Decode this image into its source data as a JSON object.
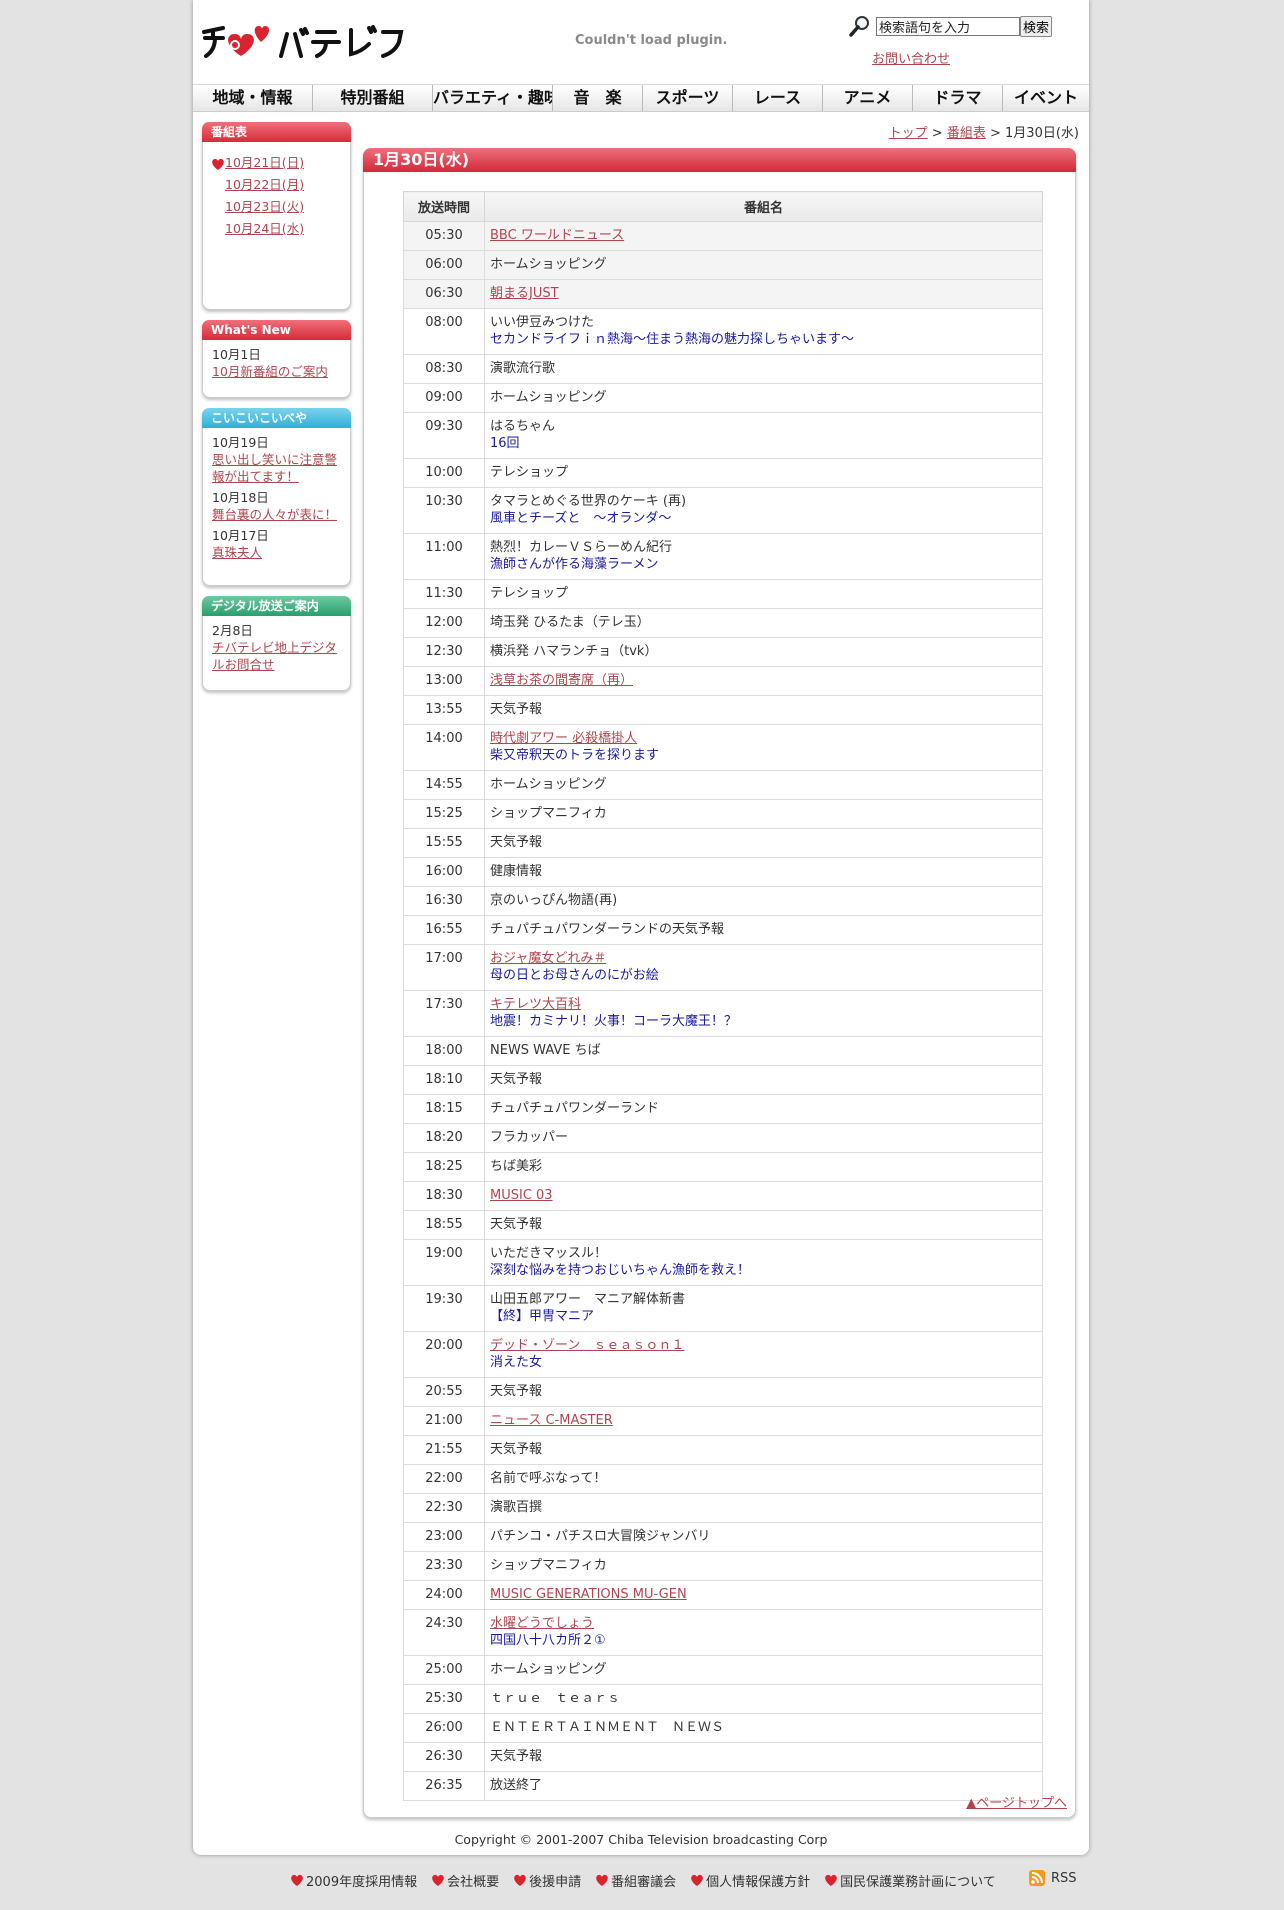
{
  "header": {
    "logo_text": "チバテレビ",
    "plugin_message": "Couldn't load plugin.",
    "search": {
      "value": "検索語句を入力",
      "button": "検索"
    },
    "contact": "お問い合わせ"
  },
  "nav": [
    {
      "label": "地域・情報",
      "width": 120
    },
    {
      "label": "特別番組",
      "width": 120
    },
    {
      "label": "バラエティ・趣味",
      "width": 120
    },
    {
      "label": "音　楽",
      "width": 90
    },
    {
      "label": "スポーツ",
      "width": 90
    },
    {
      "label": "レース",
      "width": 90
    },
    {
      "label": "アニメ",
      "width": 90
    },
    {
      "label": "ドラマ",
      "width": 90
    },
    {
      "label": "イベント",
      "width": 86
    }
  ],
  "sidebar": {
    "schedule": {
      "title": "番組表",
      "days": [
        "10月21日(日)",
        "10月22日(月)",
        "10月23日(火)",
        "10月24日(水)"
      ]
    },
    "whats_new": {
      "title": "What's New",
      "items": [
        {
          "date": "10月1日",
          "text": "10月新番組のご案内"
        }
      ]
    },
    "koikoi": {
      "title": "こいこいこいべや",
      "items": [
        {
          "date": "10月19日",
          "text": "思い出し笑いに注意警報が出てます！"
        },
        {
          "date": "10月18日",
          "text": "舞台裏の人々が表に！"
        },
        {
          "date": "10月17日",
          "text": "真珠夫人"
        }
      ]
    },
    "digital": {
      "title": "デジタル放送ご案内",
      "items": [
        {
          "date": "2月8日",
          "text": "チバテレビ地上デジタルお問合せ"
        }
      ]
    }
  },
  "breadcrumb": {
    "top": "トップ",
    "schedule": "番組表",
    "current": "1月30日(水)",
    "sep": " > "
  },
  "main": {
    "date_title": "1月30日(水)",
    "columns": [
      "放送時間",
      "番組名"
    ],
    "rows": [
      {
        "time": "05:30",
        "title": "BBC ワールドニュース",
        "link": true
      },
      {
        "time": "06:00",
        "title": "ホームショッピング"
      },
      {
        "time": "06:30",
        "title": "朝まるJUST",
        "link": true
      },
      {
        "time": "08:00",
        "title": "いい伊豆みつけた",
        "sub": "セカンドライフｉｎ熱海～住まう熱海の魅力探しちゃいます～"
      },
      {
        "time": "08:30",
        "title": "演歌流行歌"
      },
      {
        "time": "09:00",
        "title": "ホームショッピング"
      },
      {
        "time": "09:30",
        "title": "はるちゃん",
        "sub": "16回"
      },
      {
        "time": "10:00",
        "title": "テレショップ"
      },
      {
        "time": "10:30",
        "title": "タマラとめぐる世界のケーキ (再)",
        "sub": "風車とチーズと　～オランダ～"
      },
      {
        "time": "11:00",
        "title": "熱烈！カレーＶＳらーめん紀行",
        "sub": "漁師さんが作る海藻ラーメン"
      },
      {
        "time": "11:30",
        "title": "テレショップ"
      },
      {
        "time": "12:00",
        "title": "埼玉発 ひるたま（テレ玉）"
      },
      {
        "time": "12:30",
        "title": "横浜発 ハマランチョ（tvk）"
      },
      {
        "time": "13:00",
        "title": "浅草お茶の間寄席（再）",
        "link": true
      },
      {
        "time": "13:55",
        "title": "天気予報"
      },
      {
        "time": "14:00",
        "title": "時代劇アワー 必殺橋掛人",
        "link": true,
        "sub": "柴又帝釈天のトラを探ります"
      },
      {
        "time": "14:55",
        "title": "ホームショッピング"
      },
      {
        "time": "15:25",
        "title": "ショップマニフィカ"
      },
      {
        "time": "15:55",
        "title": "天気予報"
      },
      {
        "time": "16:00",
        "title": "健康情報"
      },
      {
        "time": "16:30",
        "title": "京のいっぴん物語(再)"
      },
      {
        "time": "16:55",
        "title": "チュパチュパワンダーランドの天気予報"
      },
      {
        "time": "17:00",
        "title": "おジャ魔女どれみ＃",
        "link": true,
        "sub": "母の日とお母さんのにがお絵"
      },
      {
        "time": "17:30",
        "title": "キテレツ大百科",
        "link": true,
        "sub": "地震！カミナリ！火事！コーラ大魔王！？"
      },
      {
        "time": "18:00",
        "title": "NEWS WAVE ちば"
      },
      {
        "time": "18:10",
        "title": "天気予報"
      },
      {
        "time": "18:15",
        "title": "チュパチュパワンダーランド"
      },
      {
        "time": "18:20",
        "title": "フラカッパー"
      },
      {
        "time": "18:25",
        "title": "ちば美彩"
      },
      {
        "time": "18:30",
        "title": "MUSIC 03",
        "link": true
      },
      {
        "time": "18:55",
        "title": "天気予報"
      },
      {
        "time": "19:00",
        "title": "いただきマッスル！",
        "sub": "深刻な悩みを持つおじいちゃん漁師を救え！"
      },
      {
        "time": "19:30",
        "title": "山田五郎アワー　マニア解体新書",
        "sub": "【終】甲冑マニア"
      },
      {
        "time": "20:00",
        "title": "デッド・ゾーン　ｓｅａｓｏｎ１",
        "link": true,
        "sub": "消えた女"
      },
      {
        "time": "20:55",
        "title": "天気予報"
      },
      {
        "time": "21:00",
        "title": "ニュース C-MASTER",
        "link": true
      },
      {
        "time": "21:55",
        "title": "天気予報"
      },
      {
        "time": "22:00",
        "title": "名前で呼ぶなって！"
      },
      {
        "time": "22:30",
        "title": "演歌百撰"
      },
      {
        "time": "23:00",
        "title": "パチンコ・パチスロ大冒険ジャンバリ"
      },
      {
        "time": "23:30",
        "title": "ショップマニフィカ"
      },
      {
        "time": "24:00",
        "title": "MUSIC GENERATIONS MU-GEN",
        "link": true
      },
      {
        "time": "24:30",
        "title": "水曜どうでしょう",
        "link": true,
        "sub": "四国八十八カ所２①"
      },
      {
        "time": "25:00",
        "title": "ホームショッピング"
      },
      {
        "time": "25:30",
        "title": "ｔｒｕｅ　ｔｅａｒｓ"
      },
      {
        "time": "26:00",
        "title": "ＥＮＴＥＲＴＡＩＮＭＥＮＴ　ＮＥＷＳ"
      },
      {
        "time": "26:30",
        "title": "天気予報"
      },
      {
        "time": "26:35",
        "title": "放送終了"
      }
    ],
    "page_top": "▲ページトップへ"
  },
  "copyright": "Copyright © 2001-2007 Chiba Television broadcasting Corp",
  "footer": {
    "links": [
      "2009年度採用情報",
      "会社概要",
      "後援申請",
      "番組審議会",
      "個人情報保護方針",
      "国民保護業務計画について"
    ],
    "rss": "RSS"
  },
  "colors": {
    "accent": "#d62b3a",
    "link": "#b0454f",
    "subtitle": "#1a1aa0"
  }
}
